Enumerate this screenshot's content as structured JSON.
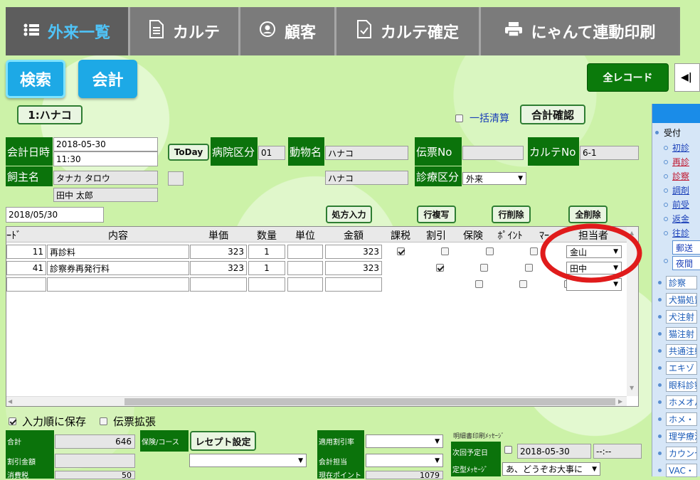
{
  "nav": {
    "tabs": [
      {
        "label": "外来一覧",
        "icon": "list-icon",
        "active": true
      },
      {
        "label": "カルテ",
        "icon": "document-icon"
      },
      {
        "label": "顧客",
        "icon": "user-circle-icon"
      },
      {
        "label": "カルテ確定",
        "icon": "document-check-icon"
      },
      {
        "label": "にゃんて連動印刷",
        "icon": "printer-icon"
      }
    ]
  },
  "actions": {
    "search": "検索",
    "checkout": "会計",
    "all_records": "全レコード",
    "prev": "◀|"
  },
  "patient_tag": "1:ハナコ",
  "bulk_settle": {
    "label": "一括清算",
    "checked": false
  },
  "total_confirm": "合計確認",
  "form": {
    "date_label": "会計日時",
    "date": "2018-05-30",
    "time": "11:30",
    "today_btn": "ToDay",
    "hospital_div_label": "病院区分",
    "hospital_div": "01",
    "animal_label": "動物名",
    "animal": "ハナコ",
    "animal_sub": "ハナコ",
    "slip_label": "伝票No",
    "slip": "",
    "chart_label": "カルテNo",
    "chart": "6-1",
    "owner_label": "飼主名",
    "owner": "タナカ タロウ",
    "owner_sub": "田中 太郎",
    "clinic_div_label": "診療区分",
    "clinic_div": "外来",
    "record_date": "2018/05/30"
  },
  "grid_buttons": {
    "prescription": "処方入力",
    "copy_row": "行複写",
    "delete_row": "行削除",
    "delete_all": "全削除"
  },
  "grid": {
    "headers": [
      "ｰﾄﾞ",
      "内容",
      "単価",
      "数量",
      "単位",
      "金額",
      "課税",
      "割引",
      "保険",
      "ﾎﾟｲﾝﾄ",
      "ﾏｰ",
      "担当者"
    ],
    "rows": [
      {
        "code": "11",
        "content": "再診料",
        "price": "323",
        "qty": "1",
        "unit": "",
        "amount": "323",
        "tax": true,
        "discount": false,
        "insurance": false,
        "point": false,
        "mark": false,
        "staff": "金山"
      },
      {
        "code": "41",
        "content": "診察券再発行料",
        "price": "323",
        "qty": "1",
        "unit": "",
        "amount": "323",
        "tax": true,
        "discount": false,
        "insurance": false,
        "point": false,
        "mark": false,
        "staff": "田中"
      },
      {
        "code": "",
        "content": "",
        "price": "",
        "qty": "",
        "unit": "",
        "amount": "",
        "tax": false,
        "discount": false,
        "insurance": false,
        "point": false,
        "mark": false,
        "staff": ""
      }
    ]
  },
  "options": {
    "input_order": "入力順に保存",
    "input_order_checked": true,
    "slip_expand": "伝票拡張",
    "slip_expand_checked": false
  },
  "summary": {
    "total_label": "合計",
    "total": "646",
    "discount_label": "割引金額",
    "discount": "",
    "tax_label": "消費税",
    "tax": "50",
    "insurance_label": "保険/コース",
    "receipt_btn": "レセプト設定",
    "rate_label": "適用割引率",
    "staff_label": "会計担当",
    "points_label": "現在ポイント",
    "points": "1079",
    "print_msg_label": "明細書印刷ﾒｯｾｰｼﾞ",
    "next_date_label": "次回予定日",
    "next_date": "2018-05-30",
    "next_time": "--:--",
    "fixed_msg_label": "定型ﾒｯｾｰｼﾞ",
    "fixed_msg": "あ、どうぞお大事に"
  },
  "sidebar": {
    "header": "",
    "groups": [
      {
        "label": "受付",
        "items": [
          "初診",
          "再診",
          "診察",
          "調剤",
          "前受",
          "返金",
          "往診"
        ],
        "boxes": [
          "郵送",
          "夜間"
        ]
      }
    ],
    "links": [
      "診察",
      "犬猫処置",
      "犬注射",
      "猫注射",
      "共通注射",
      "エキゾ",
      "眼科診察",
      "ホメオパシー",
      "ホメ・",
      "理学療法",
      "カウンセリング",
      "VAC・"
    ]
  }
}
